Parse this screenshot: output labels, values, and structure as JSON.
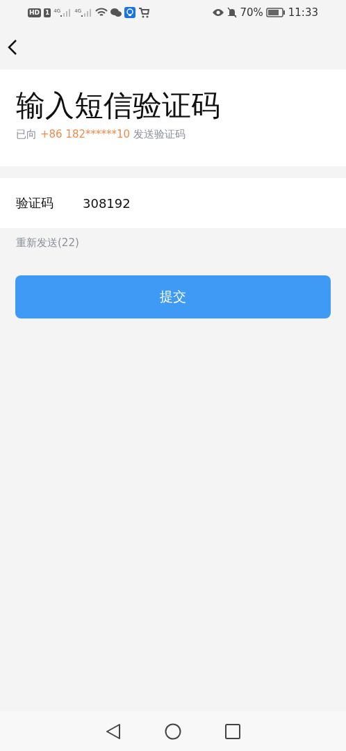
{
  "status_bar": {
    "hd_badge": "HD",
    "sim_badge": "1",
    "signals": [
      {
        "label": "4G"
      },
      {
        "label": "4G"
      }
    ],
    "battery": "70%",
    "time": "11:33"
  },
  "title": "输入短信验证码",
  "subtitle": {
    "prefix": "已向",
    "phone": "+86 182******10",
    "suffix": "发送验证码"
  },
  "code_field": {
    "label": "验证码",
    "value": "308192"
  },
  "resend": "重新发送(22)",
  "submit": "提交"
}
